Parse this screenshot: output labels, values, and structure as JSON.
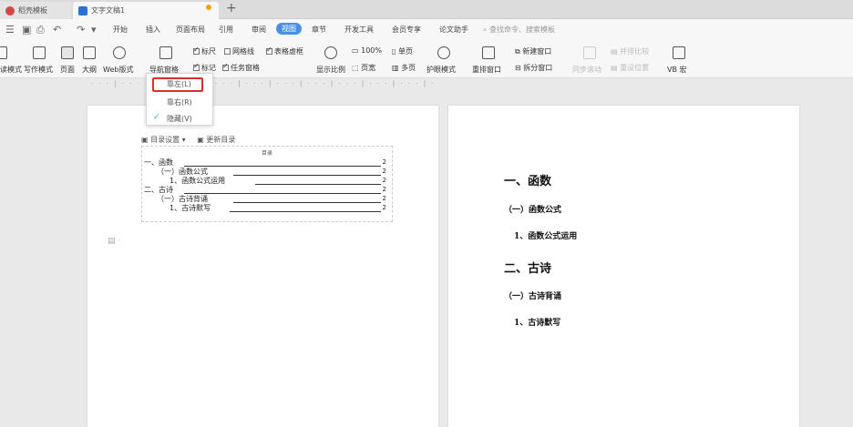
{
  "tabs": [
    {
      "label": "稻壳模板"
    },
    {
      "label": "文字文稿1"
    }
  ],
  "menu": {
    "items": [
      "开始",
      "插入",
      "页面布局",
      "引用",
      "审阅",
      "视图",
      "章节",
      "开发工具",
      "会员专享",
      "论文助手"
    ],
    "active": "视图",
    "search": "查找命令、搜索模板"
  },
  "ribbon": {
    "read_mode": "读模式",
    "write_mode": "写作模式",
    "page_view": "页面",
    "outline": "大纲",
    "web_layout": "Web版式",
    "nav_pane": "导航窗格",
    "ruler": "标尺",
    "gridlines": "网格线",
    "tables": "表格虚框",
    "markup": "标记",
    "task_pane": "任务窗格",
    "zoom": "显示比例",
    "zoom_value": "100%",
    "single_page": "单页",
    "page_width": "页宽",
    "multi_page": "多页",
    "eye_mode": "护眼模式",
    "rearrange": "重排窗口",
    "new_window": "新建窗口",
    "split_window": "拆分窗口",
    "sync_scroll": "同步滚动",
    "side_by_side": "并排比较",
    "reset_pos": "重设位置",
    "vb_macro": "VB 宏"
  },
  "dropdown": {
    "items": [
      "靠左(L)",
      "靠右(R)",
      "隐藏(V)"
    ],
    "checked": "隐藏(V)"
  },
  "toc": {
    "settings": "目录设置",
    "update": "更新目录",
    "title": "目录",
    "entries": [
      {
        "text": "一、函数",
        "page": "2"
      },
      {
        "text": "（一）函数公式",
        "page": "2"
      },
      {
        "text": "1、函数公式运用",
        "page": "2"
      },
      {
        "text": "二、古诗",
        "page": "2"
      },
      {
        "text": "（一）古诗背诵",
        "page": "2"
      },
      {
        "text": "1、古诗默写",
        "page": "2"
      }
    ]
  },
  "doc": {
    "h1_a": "一、函数",
    "h2_a": "（一）函数公式",
    "h3_a": "1、函数公式运用",
    "h1_b": "二、古诗",
    "h2_b": "（一）古诗背诵",
    "h3_b": "1、古诗默写"
  }
}
